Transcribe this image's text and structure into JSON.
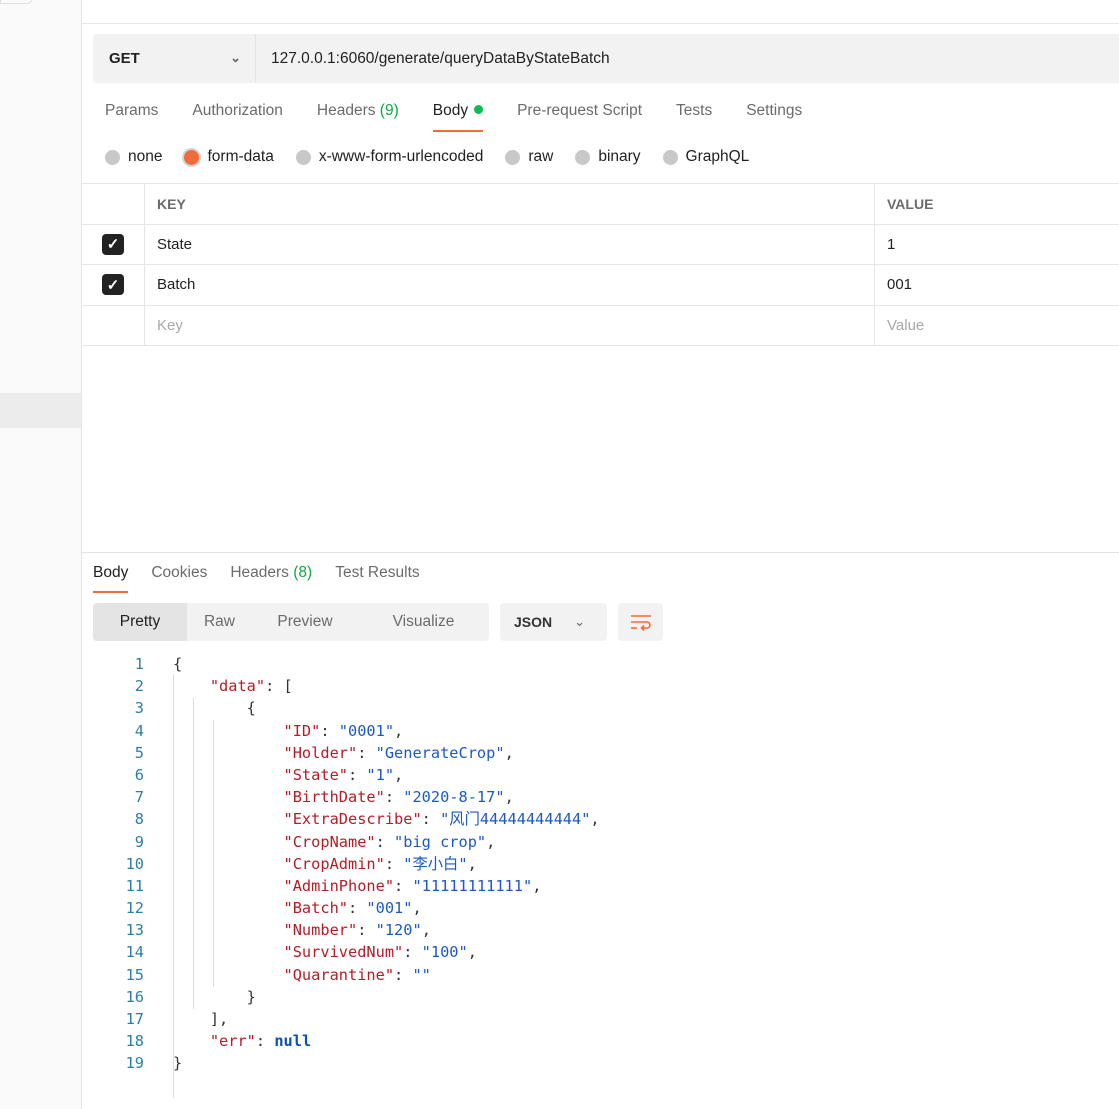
{
  "request": {
    "method": "GET",
    "url": "127.0.0.1:6060/generate/queryDataByStateBatch"
  },
  "request_tabs": [
    {
      "label": "Params"
    },
    {
      "label": "Authorization"
    },
    {
      "label": "Headers",
      "count": "(9)"
    },
    {
      "label": "Body",
      "active": true
    },
    {
      "label": "Pre-request Script"
    },
    {
      "label": "Tests"
    },
    {
      "label": "Settings"
    }
  ],
  "body_types": [
    {
      "label": "none"
    },
    {
      "label": "form-data",
      "selected": true
    },
    {
      "label": "x-www-form-urlencoded"
    },
    {
      "label": "raw"
    },
    {
      "label": "binary"
    },
    {
      "label": "GraphQL"
    }
  ],
  "form_table": {
    "headers": {
      "key": "KEY",
      "value": "VALUE"
    },
    "rows": [
      {
        "key": "State",
        "value": "1",
        "checked": true
      },
      {
        "key": "Batch",
        "value": "001",
        "checked": true
      }
    ],
    "placeholder": {
      "key": "Key",
      "value": "Value"
    }
  },
  "response_tabs": [
    {
      "label": "Body",
      "active": true
    },
    {
      "label": "Cookies"
    },
    {
      "label": "Headers",
      "count": "(8)"
    },
    {
      "label": "Test Results"
    }
  ],
  "view_modes": [
    "Pretty",
    "Raw",
    "Preview",
    "Visualize"
  ],
  "active_view_mode": "Pretty",
  "format": "JSON",
  "icons": {
    "method_dropdown": "chevron-down-icon",
    "wrap": "wrap-lines-icon",
    "check": "checkmark-icon"
  },
  "colors": {
    "accent": "#f26b3a",
    "count": "#0caa41",
    "key": "#b31d28",
    "string": "#1b59c4"
  },
  "code_lines": [
    {
      "n": "1",
      "t": [
        [
          "pun",
          "{"
        ]
      ]
    },
    {
      "n": "2",
      "t": [
        [
          "pun",
          "    "
        ],
        [
          "key",
          "\"data\""
        ],
        [
          "pun",
          ": ["
        ]
      ]
    },
    {
      "n": "3",
      "t": [
        [
          "pun",
          "        {"
        ]
      ]
    },
    {
      "n": "4",
      "t": [
        [
          "pun",
          "            "
        ],
        [
          "key",
          "\"ID\""
        ],
        [
          "pun",
          ": "
        ],
        [
          "str",
          "\"0001\""
        ],
        [
          "pun",
          ","
        ]
      ]
    },
    {
      "n": "5",
      "t": [
        [
          "pun",
          "            "
        ],
        [
          "key",
          "\"Holder\""
        ],
        [
          "pun",
          ": "
        ],
        [
          "str",
          "\"GenerateCrop\""
        ],
        [
          "pun",
          ","
        ]
      ]
    },
    {
      "n": "6",
      "t": [
        [
          "pun",
          "            "
        ],
        [
          "key",
          "\"State\""
        ],
        [
          "pun",
          ": "
        ],
        [
          "str",
          "\"1\""
        ],
        [
          "pun",
          ","
        ]
      ]
    },
    {
      "n": "7",
      "t": [
        [
          "pun",
          "            "
        ],
        [
          "key",
          "\"BirthDate\""
        ],
        [
          "pun",
          ": "
        ],
        [
          "str",
          "\"2020-8-17\""
        ],
        [
          "pun",
          ","
        ]
      ]
    },
    {
      "n": "8",
      "t": [
        [
          "pun",
          "            "
        ],
        [
          "key",
          "\"ExtraDescribe\""
        ],
        [
          "pun",
          ": "
        ],
        [
          "str",
          "\"风门44444444444\""
        ],
        [
          "pun",
          ","
        ]
      ]
    },
    {
      "n": "9",
      "t": [
        [
          "pun",
          "            "
        ],
        [
          "key",
          "\"CropName\""
        ],
        [
          "pun",
          ": "
        ],
        [
          "str",
          "\"big crop\""
        ],
        [
          "pun",
          ","
        ]
      ]
    },
    {
      "n": "10",
      "t": [
        [
          "pun",
          "            "
        ],
        [
          "key",
          "\"CropAdmin\""
        ],
        [
          "pun",
          ": "
        ],
        [
          "str",
          "\"李小白\""
        ],
        [
          "pun",
          ","
        ]
      ]
    },
    {
      "n": "11",
      "t": [
        [
          "pun",
          "            "
        ],
        [
          "key",
          "\"AdminPhone\""
        ],
        [
          "pun",
          ": "
        ],
        [
          "str",
          "\"11111111111\""
        ],
        [
          "pun",
          ","
        ]
      ]
    },
    {
      "n": "12",
      "t": [
        [
          "pun",
          "            "
        ],
        [
          "key",
          "\"Batch\""
        ],
        [
          "pun",
          ": "
        ],
        [
          "str",
          "\"001\""
        ],
        [
          "pun",
          ","
        ]
      ]
    },
    {
      "n": "13",
      "t": [
        [
          "pun",
          "            "
        ],
        [
          "key",
          "\"Number\""
        ],
        [
          "pun",
          ": "
        ],
        [
          "str",
          "\"120\""
        ],
        [
          "pun",
          ","
        ]
      ]
    },
    {
      "n": "14",
      "t": [
        [
          "pun",
          "            "
        ],
        [
          "key",
          "\"SurvivedNum\""
        ],
        [
          "pun",
          ": "
        ],
        [
          "str",
          "\"100\""
        ],
        [
          "pun",
          ","
        ]
      ]
    },
    {
      "n": "15",
      "t": [
        [
          "pun",
          "            "
        ],
        [
          "key",
          "\"Quarantine\""
        ],
        [
          "pun",
          ": "
        ],
        [
          "str",
          "\"\""
        ]
      ]
    },
    {
      "n": "16",
      "t": [
        [
          "pun",
          "        }"
        ]
      ]
    },
    {
      "n": "17",
      "t": [
        [
          "pun",
          "    ],"
        ]
      ]
    },
    {
      "n": "18",
      "t": [
        [
          "pun",
          "    "
        ],
        [
          "key",
          "\"err\""
        ],
        [
          "pun",
          ": "
        ],
        [
          "kw",
          "null"
        ]
      ]
    },
    {
      "n": "19",
      "t": [
        [
          "pun",
          "}"
        ]
      ]
    }
  ]
}
